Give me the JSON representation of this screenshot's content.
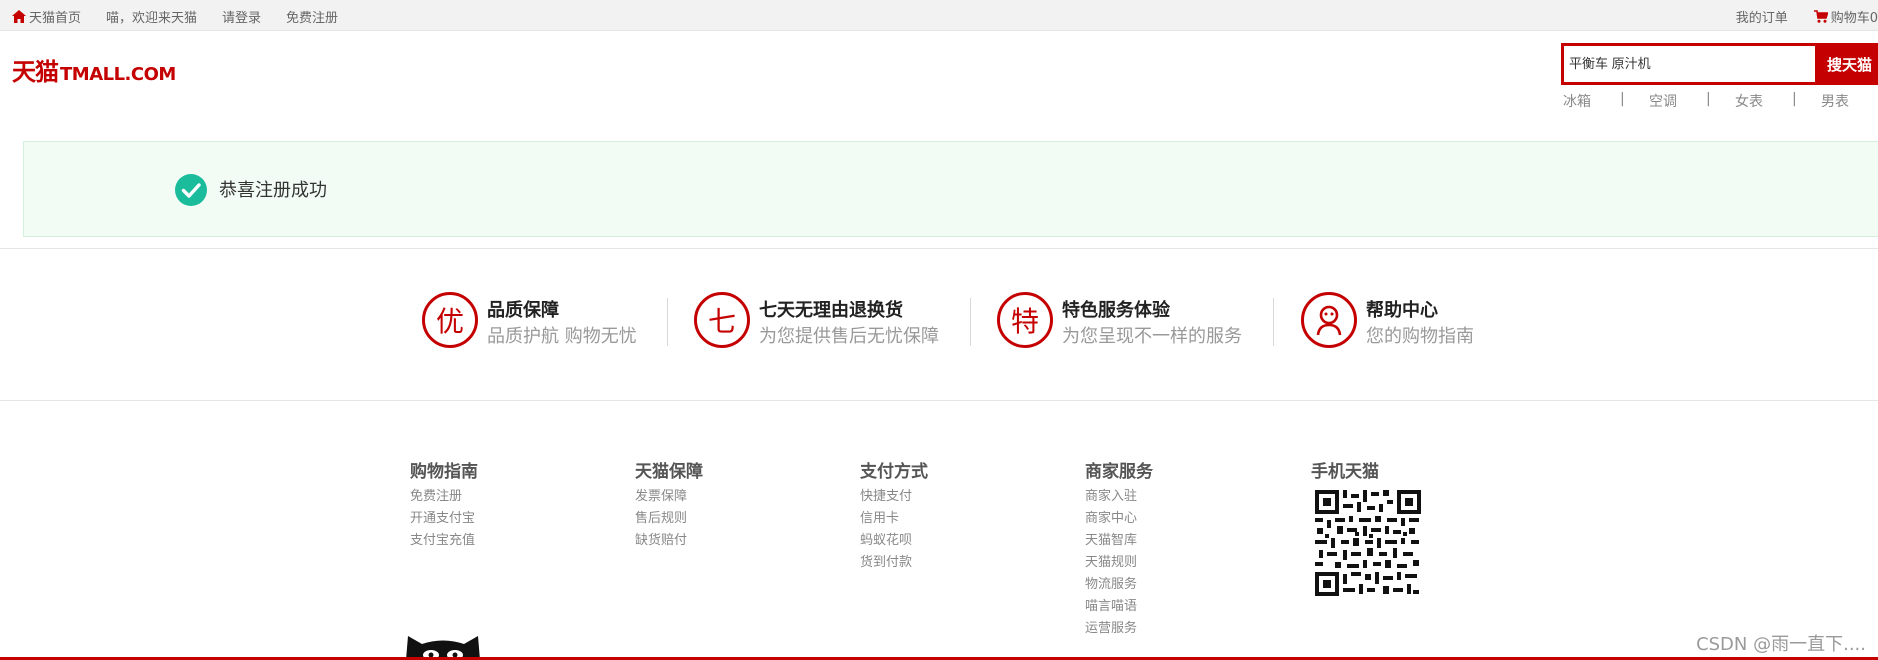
{
  "topbar": {
    "home": "天猫首页",
    "welcome": "喵，欢迎来天猫",
    "login": "请登录",
    "register": "免费注册",
    "orders": "我的订单",
    "cart": "购物车0"
  },
  "logo": {
    "cn": "天猫",
    "en": "TMALL.COM"
  },
  "search": {
    "value": "平衡车 原汁机",
    "button": "搜天猫"
  },
  "hotwords": [
    "冰箱",
    "空调",
    "女表",
    "男表"
  ],
  "hotword_sep": "|",
  "banner": {
    "message": "恭喜注册成功"
  },
  "services": [
    {
      "icon": "优",
      "title": "品质保障",
      "subtitle": "品质护航 购物无忧"
    },
    {
      "icon": "七",
      "title": "七天无理由退换货",
      "subtitle": "为您提供售后无忧保障"
    },
    {
      "icon": "特",
      "title": "特色服务体验",
      "subtitle": "为您呈现不一样的服务"
    },
    {
      "icon": "help-face-icon",
      "title": "帮助中心",
      "subtitle": "您的购物指南"
    }
  ],
  "footer": {
    "columns": [
      {
        "title": "购物指南",
        "links": [
          "免费注册",
          "开通支付宝",
          "支付宝充值"
        ]
      },
      {
        "title": "天猫保障",
        "links": [
          "发票保障",
          "售后规则",
          "缺货赔付"
        ]
      },
      {
        "title": "支付方式",
        "links": [
          "快捷支付",
          "信用卡",
          "蚂蚁花呗",
          "货到付款"
        ]
      },
      {
        "title": "商家服务",
        "links": [
          "商家入驻",
          "商家中心",
          "天猫智库",
          "天猫规则",
          "物流服务",
          "喵言喵语",
          "运营服务"
        ]
      }
    ],
    "mobile_title": "手机天猫"
  },
  "watermark": "CSDN @雨一直下....",
  "colors": {
    "brand": "#c40000",
    "success": "#1abc9c",
    "banner_bg": "#f2fcf5"
  }
}
